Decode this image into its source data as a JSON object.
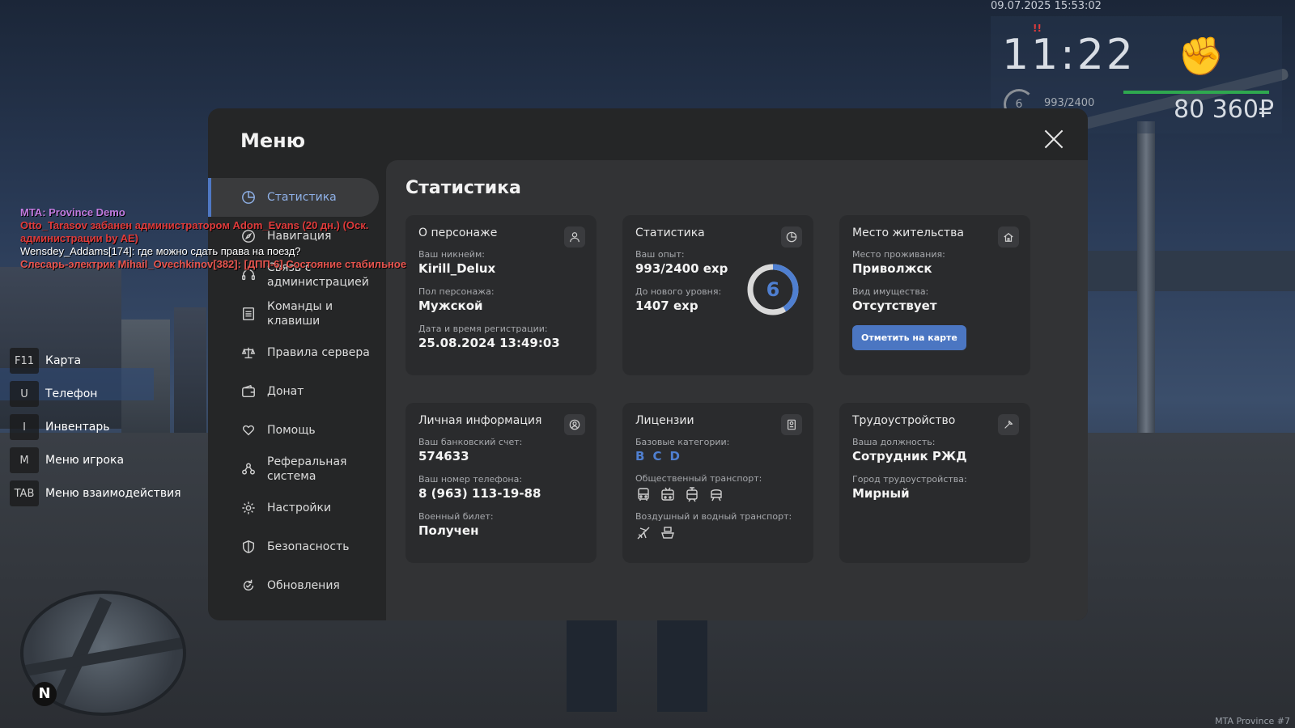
{
  "hud": {
    "datetime": "09.07.2025 15:53:02",
    "marker": "!!",
    "time": "11:22",
    "level": "6",
    "exp": "993/2400",
    "money": "80 360₽"
  },
  "chat": [
    {
      "text": "MTA: Province Demo",
      "color": "#c27be0"
    },
    {
      "text": "Otto_Tarasov забанен администратором Adom_Evans (20 дн.) (Оск. администрации by AE)",
      "color": "#e03b3b"
    },
    {
      "text": "Wensdey_Addams[174]: где можно сдать права на поезд?",
      "color": "#ffffff"
    },
    {
      "text": "Слесарь-электрик Mihail_Ovechkinov[382]: [ДПП-6] Состояние стабильное",
      "color": "#e8554f"
    }
  ],
  "hotkeys": [
    {
      "key": "F11",
      "label": "Карта"
    },
    {
      "key": "U",
      "label": "Телефон"
    },
    {
      "key": "I",
      "label": "Инвентарь"
    },
    {
      "key": "M",
      "label": "Меню игрока"
    },
    {
      "key": "TAB",
      "label": "Меню взаимодействия"
    }
  ],
  "minimap": {
    "north": "N"
  },
  "watermark": "MTA Province #7",
  "menu": {
    "title": "Меню",
    "nav": [
      {
        "label": "Статистика",
        "icon": "pie-chart-icon",
        "active": true
      },
      {
        "label": "Навигация",
        "icon": "compass-icon"
      },
      {
        "label": "Связь с администрацией",
        "icon": "headset-icon"
      },
      {
        "label": "Команды и клавиши",
        "icon": "list-icon"
      },
      {
        "label": "Правила сервера",
        "icon": "scales-icon"
      },
      {
        "label": "Донат",
        "icon": "wallet-icon"
      },
      {
        "label": "Помощь",
        "icon": "heart-hand-icon"
      },
      {
        "label": "Реферальная система",
        "icon": "people-icon"
      },
      {
        "label": "Настройки",
        "icon": "gear-icon"
      },
      {
        "label": "Безопасность",
        "icon": "shield-icon"
      },
      {
        "label": "Обновления",
        "icon": "refresh-icon"
      }
    ]
  },
  "content": {
    "title": "Статистика",
    "character": {
      "title": "О персонаже",
      "nickname_label": "Ваш никнейм:",
      "nickname": "Kirill_Delux",
      "gender_label": "Пол персонажа:",
      "gender": "Мужской",
      "reg_label": "Дата и время регистрации:",
      "reg": "25.08.2024 13:49:03"
    },
    "stats": {
      "title": "Статистика",
      "exp_label": "Ваш опыт:",
      "exp": "993/2400 exp",
      "next_label": "До нового уровня:",
      "next": "1407 exp",
      "level": "6",
      "progress": 0.414
    },
    "residence": {
      "title": "Место жительства",
      "place_label": "Место проживания:",
      "place": "Приволжск",
      "property_label": "Вид имущества:",
      "property": "Отсутствует",
      "button": "Отметить на карте"
    },
    "personal": {
      "title": "Личная информация",
      "bank_label": "Ваш банковский счет:",
      "bank": "574633",
      "phone_label": "Ваш номер телефона:",
      "phone": "8 (963) 113-19-88",
      "military_label": "Военный билет:",
      "military": "Получен"
    },
    "licenses": {
      "title": "Лицензии",
      "base_label": "Базовые категории:",
      "categories": [
        "B",
        "C",
        "D"
      ],
      "public_label": "Общественный транспорт:",
      "public_icons": [
        "bus-icon",
        "trolleybus-icon",
        "tram-icon",
        "train-icon"
      ],
      "air_label": "Воздушный и водный транспорт:",
      "air_icons": [
        "plane-icon",
        "boat-icon"
      ]
    },
    "job": {
      "title": "Трудоустройство",
      "position_label": "Ваша должность:",
      "position": "Сотрудник РЖД",
      "city_label": "Город трудоустройства:",
      "city": "Мирный"
    }
  },
  "colors": {
    "accent": "#4f78c4",
    "card_bg": "#2a2b2d",
    "panel_bg": "#323335"
  }
}
